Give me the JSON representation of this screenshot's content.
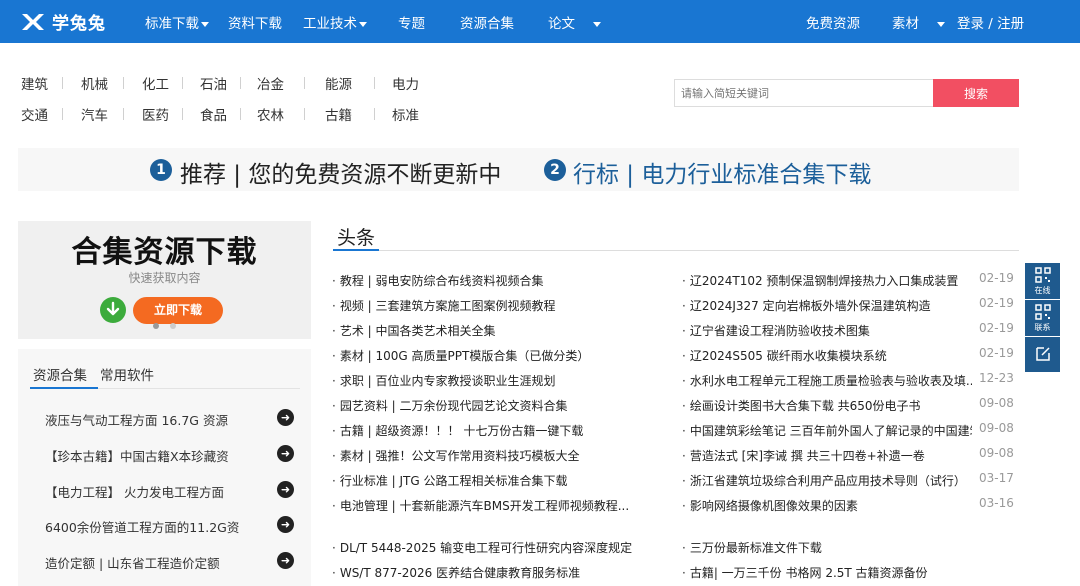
{
  "header": {
    "logo_text": "学兔兔",
    "nav": [
      {
        "label": "标准下载",
        "dropdown": true
      },
      {
        "label": "资料下载",
        "dropdown": false
      },
      {
        "label": "工业技术",
        "dropdown": true
      },
      {
        "label": "专题",
        "dropdown": false
      },
      {
        "label": "资源合集",
        "dropdown": false
      },
      {
        "label": "论文",
        "dropdown": true
      },
      {
        "label": "免费资源",
        "dropdown": false
      },
      {
        "label": "素材",
        "dropdown": true
      }
    ],
    "login_label": "登录 / 注册"
  },
  "categories": {
    "row1": [
      "建筑",
      "机械",
      "化工",
      "石油",
      "冶金",
      "能源",
      "电力"
    ],
    "row2": [
      "交通",
      "汽车",
      "医药",
      "食品",
      "农林",
      "古籍",
      "标准"
    ]
  },
  "search": {
    "placeholder": "请输入简短关键词",
    "button_label": "搜索"
  },
  "banner": {
    "item1_num": "1",
    "item1_text": "推荐 | 您的免费资源不断更新中",
    "item2_num": "2",
    "item2_text": "行标 | 电力行业标准合集下载"
  },
  "promo": {
    "title": "合集资源下载",
    "subtitle": "快速获取内容",
    "button_label": "立即下载"
  },
  "left_panel": {
    "tabs": [
      "资源合集",
      "常用软件"
    ],
    "items": [
      "液压与气动工程方面 16.7G 资源",
      "【珍本古籍】中国古籍X本珍藏资",
      "【电力工程】 火力发电工程方面",
      "6400余份管道工程方面的11.2G资",
      "造价定额 | 山东省工程造价定额"
    ]
  },
  "headlines": {
    "title": "头条",
    "left": [
      "教程 | 弱电安防综合布线资料视频合集",
      "视频 | 三套建筑方案施工图案例视频教程",
      "艺术 | 中国各类艺术相关全集",
      "素材 | 100G 高质量PPT模版合集（已做分类）",
      "求职 | 百位业内专家教授谈职业生涯规划",
      "园艺资料 | 二万余份现代园艺论文资料合集",
      "古籍 | 超级资源！！！ 十七万份古籍一键下载",
      "素材 | 强推！公文写作常用资料技巧模板大全",
      "行业标准 | JTG 公路工程相关标准合集下载",
      "电池管理 | 十套新能源汽车BMS开发工程师视频教程..."
    ],
    "right": [
      {
        "text": "辽2024T102 预制保温钢制焊接热力入口集成装置",
        "date": "02-19"
      },
      {
        "text": "辽2024J327 定向岩棉板外墙外保温建筑构造",
        "date": "02-19"
      },
      {
        "text": "辽宁省建设工程消防验收技术图集",
        "date": "02-19"
      },
      {
        "text": "辽2024S505 碳纤雨水收集模块系统",
        "date": "02-19"
      },
      {
        "text": "水利水电工程单元工程施工质量检验表与验收表及填...",
        "date": "12-23"
      },
      {
        "text": "绘画设计类图书大合集下载 共650份电子书",
        "date": "09-08"
      },
      {
        "text": "中国建筑彩绘笔记 三百年前外国人了解记录的中国建筑",
        "date": "09-08"
      },
      {
        "text": "营造法式 [宋]李诫 撰 共三十四卷+补遗一卷",
        "date": "09-08"
      },
      {
        "text": "浙江省建筑垃圾综合利用产品应用技术导则（试行）",
        "date": "03-17"
      },
      {
        "text": "影响网络摄像机图像效果的因素",
        "date": "03-16"
      }
    ],
    "bottom_left": [
      "DL/T 5448-2025 输变电工程可行性研究内容深度规定",
      "WS/T 877-2026 医养结合健康教育服务标准"
    ],
    "bottom_right": [
      "三万份最新标准文件下载",
      "古籍| 一万三千份 书格网 2.5T 古籍资源备份"
    ]
  },
  "side": {
    "online_label": "在线",
    "contact_label": "联系"
  },
  "colors": {
    "nav_bg": "#1976d2",
    "search_button": "#f24f62",
    "banner_number": "#1c5f9a",
    "side_bar": "#1f5a8e"
  }
}
